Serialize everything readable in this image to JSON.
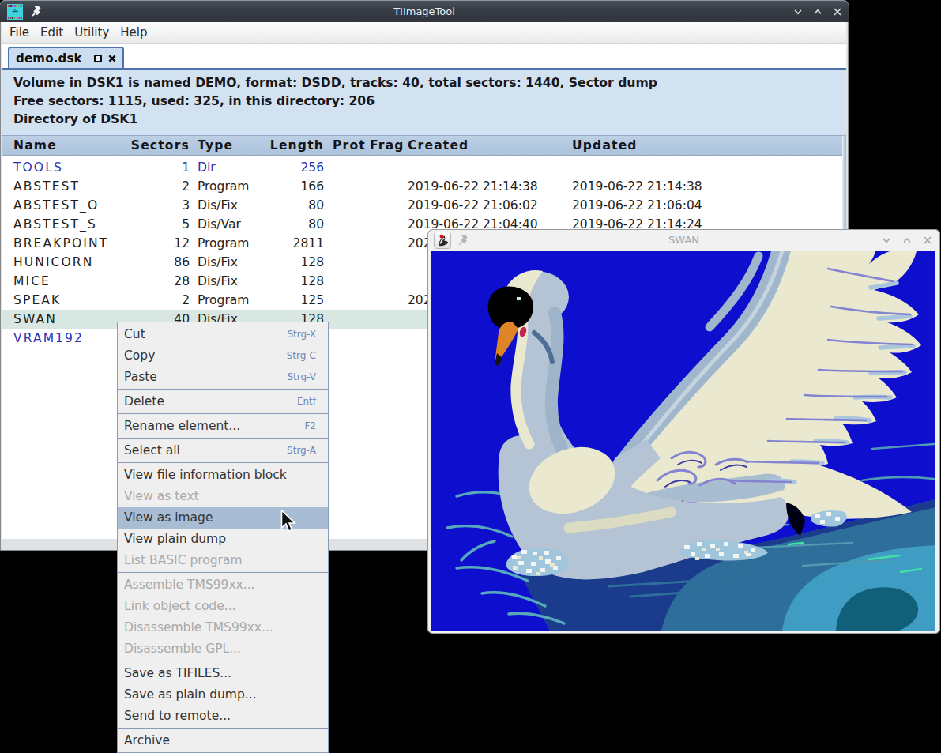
{
  "desktop": {
    "background": "#000000"
  },
  "colors": {
    "titlebar-bg": "#383e46",
    "titlebar-top": "#4a5059",
    "titlebar-text": "#e8ecee",
    "content-bg": "#d3e2f1",
    "tab-bg": "#cbdef1",
    "tab-border": "#4f72ac",
    "table-header-bg": "#abc4dc",
    "table-header-top": "#bdd0e4",
    "selection-row": "#d9e7e2",
    "link-blue": "#2833b4",
    "menu-highlight": "#a8bcd4",
    "menu-shortcut": "#6c87b8",
    "swan-bg": "#0e0ece",
    "swan-body": "#b4c4d4",
    "swan-cream": "#ebe8d0",
    "water-teal": "#3f9cc3"
  },
  "main_window": {
    "title": "TIImageTool",
    "controls": {
      "minimize": "chevron-down",
      "maximize": "chevron-up",
      "close": "x"
    },
    "menu": [
      "File",
      "Edit",
      "Utility",
      "Help"
    ],
    "tab": {
      "label": "demo.dsk"
    },
    "info_lines": [
      "Volume in DSK1 is named DEMO, format: DSDD, tracks: 40, total sectors: 1440, Sector dump",
      "Free sectors: 1115, used: 325, in this directory: 206",
      "Directory of DSK1"
    ],
    "table": {
      "columns": [
        "Name",
        "Sectors",
        "Type",
        "Length",
        "Prot",
        "Frag",
        "Created",
        "Updated"
      ],
      "rows": [
        {
          "name": "TOOLS",
          "sectors": "1",
          "type": "Dir",
          "length": "256",
          "prot": "",
          "frag": "",
          "created": "",
          "updated": "",
          "dir": true,
          "selected": false
        },
        {
          "name": "ABSTEST",
          "sectors": "2",
          "type": "Program",
          "length": "166",
          "prot": "",
          "frag": "",
          "created": "2019-06-22 21:14:38",
          "updated": "2019-06-22 21:14:38",
          "dir": false,
          "selected": false
        },
        {
          "name": "ABSTEST_O",
          "sectors": "3",
          "type": "Dis/Fix",
          "length": "80",
          "prot": "",
          "frag": "",
          "created": "2019-06-22 21:06:02",
          "updated": "2019-06-22 21:06:04",
          "dir": false,
          "selected": false
        },
        {
          "name": "ABSTEST_S",
          "sectors": "5",
          "type": "Dis/Var",
          "length": "80",
          "prot": "",
          "frag": "",
          "created": "2019-06-22 21:04:40",
          "updated": "2019-06-22 21:14:24",
          "dir": false,
          "selected": false
        },
        {
          "name": "BREAKPOINT",
          "sectors": "12",
          "type": "Program",
          "length": "2811",
          "prot": "",
          "frag": "",
          "created": "202",
          "updated": "",
          "dir": false,
          "selected": false
        },
        {
          "name": "HUNICORN",
          "sectors": "86",
          "type": "Dis/Fix",
          "length": "128",
          "prot": "",
          "frag": "",
          "created": "",
          "updated": "",
          "dir": false,
          "selected": false
        },
        {
          "name": "MICE",
          "sectors": "28",
          "type": "Dis/Fix",
          "length": "128",
          "prot": "",
          "frag": "",
          "created": "",
          "updated": "",
          "dir": false,
          "selected": false
        },
        {
          "name": "SPEAK",
          "sectors": "2",
          "type": "Program",
          "length": "125",
          "prot": "",
          "frag": "",
          "created": "202",
          "updated": "",
          "dir": false,
          "selected": false
        },
        {
          "name": "SWAN",
          "sectors": "40",
          "type": "Dis/Fix",
          "length": "128",
          "prot": "",
          "frag": "",
          "created": "",
          "updated": "",
          "dir": false,
          "selected": true
        },
        {
          "name": "VRAM192",
          "sectors": "",
          "type": "",
          "length": "",
          "prot": "",
          "frag": "",
          "created": "",
          "updated": "",
          "dir": true,
          "selected": false
        }
      ]
    }
  },
  "context_menu": {
    "items": [
      {
        "label": "Cut",
        "shortcut": "Strg-X",
        "state": "normal"
      },
      {
        "label": "Copy",
        "shortcut": "Strg-C",
        "state": "normal"
      },
      {
        "label": "Paste",
        "shortcut": "Strg-V",
        "state": "normal"
      },
      {
        "type": "separator"
      },
      {
        "label": "Delete",
        "shortcut": "Entf",
        "state": "normal"
      },
      {
        "type": "separator"
      },
      {
        "label": "Rename element...",
        "shortcut": "F2",
        "state": "normal"
      },
      {
        "type": "separator"
      },
      {
        "label": "Select all",
        "shortcut": "Strg-A",
        "state": "normal"
      },
      {
        "type": "separator"
      },
      {
        "label": "View file information block",
        "shortcut": "",
        "state": "normal"
      },
      {
        "label": "View as text",
        "shortcut": "",
        "state": "disabled"
      },
      {
        "label": "View as image",
        "shortcut": "",
        "state": "highlight"
      },
      {
        "label": "View plain dump",
        "shortcut": "",
        "state": "normal"
      },
      {
        "label": "List BASIC program",
        "shortcut": "",
        "state": "disabled"
      },
      {
        "type": "separator"
      },
      {
        "label": "Assemble TMS99xx...",
        "shortcut": "",
        "state": "disabled"
      },
      {
        "label": "Link object code...",
        "shortcut": "",
        "state": "disabled"
      },
      {
        "label": "Disassemble TMS99xx...",
        "shortcut": "",
        "state": "disabled"
      },
      {
        "label": "Disassemble GPL...",
        "shortcut": "",
        "state": "disabled"
      },
      {
        "type": "separator"
      },
      {
        "label": "Save as TIFILES...",
        "shortcut": "",
        "state": "normal"
      },
      {
        "label": "Save as plain dump...",
        "shortcut": "",
        "state": "normal"
      },
      {
        "label": "Send to remote...",
        "shortcut": "",
        "state": "normal"
      },
      {
        "type": "separator"
      },
      {
        "label": "Archive",
        "shortcut": "",
        "state": "normal"
      },
      {
        "type": "separator"
      }
    ]
  },
  "swan_window": {
    "title": "SWAN",
    "controls": {
      "minimize": "chevron-down",
      "maximize": "chevron-up",
      "close": "x"
    },
    "image": "pixel-art swan on water"
  }
}
